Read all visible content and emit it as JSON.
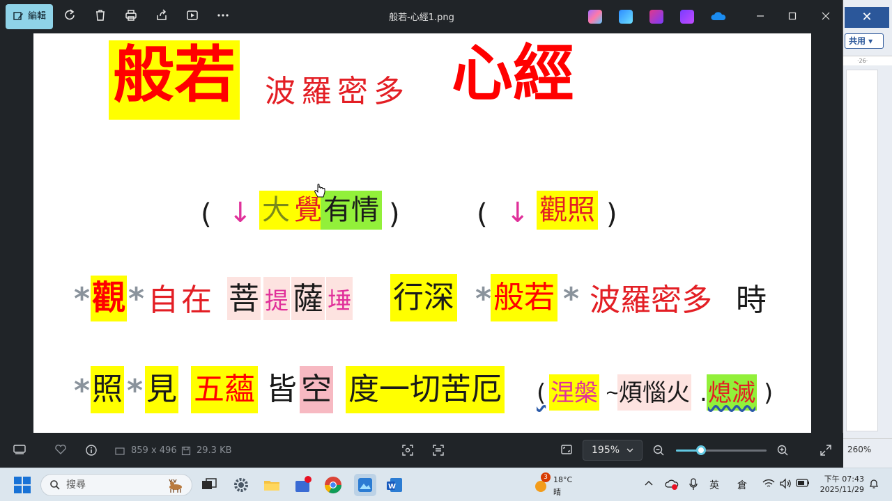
{
  "background_window": {
    "close_label": "✕",
    "share_label": "共用 ▾",
    "ruler_label": "·26·",
    "zoom_label": "260%"
  },
  "photos": {
    "title": "般若-心經1.png",
    "edit_label": "編輯",
    "file_info": {
      "dimensions": "859 x 496",
      "size": "29.3 KB"
    },
    "zoom": {
      "value_label": "195%",
      "slider_fraction": 0.28
    }
  },
  "image_text": {
    "title_1": "般若",
    "title_2": "波羅密多",
    "title_3": "心經",
    "anno1_open": "(",
    "anno1_arrow": "↓",
    "anno1_a": "大",
    "anno1_b": "覺",
    "anno1_c": "有情",
    "anno1_close": ")",
    "anno2_open": "(",
    "anno2_arrow": "↓",
    "anno2_a": "觀照",
    "anno2_close": ")",
    "l1_star1": "*",
    "l1_guan": "觀",
    "l1_star2": "*",
    "l1_zizai": "自在",
    "l1_pu": "菩",
    "l1_ti": "提",
    "l1_sa": "薩",
    "l1_chui": "埵",
    "l1_xingshen": "行深",
    "l1_star3": "*",
    "l1_banruo": "般若",
    "l1_star4": "*",
    "l1_boluo": "波羅密多",
    "l1_shi": "時",
    "l2_star1": "*",
    "l2_zhao": "照",
    "l2_star2": "*",
    "l2_jian": "見",
    "l2_wuyun": "五蘊",
    "l2_jie": "皆",
    "l2_kong": "空",
    "l2_du": "度一切苦厄",
    "l2_paren_open": "(",
    "l2_niepan": "涅槃",
    "l2_tilde": "~",
    "l2_fannao": "煩惱火",
    "l2_dot": ".",
    "l2_ximie": "熄滅",
    "l2_paren_close": ")"
  },
  "taskbar": {
    "search_placeholder": "搜尋",
    "weather_badge": "3",
    "temperature": "18°C",
    "weather_text": "晴",
    "ime_lang": "英",
    "ime_mode": "倉",
    "time": "下午 07:43",
    "date": "2025/11/29"
  },
  "colors": {
    "highlight_yellow": "#ffff00",
    "highlight_green": "#92f03a",
    "text_red": "#ff0000",
    "accent": "#62c8e2"
  }
}
